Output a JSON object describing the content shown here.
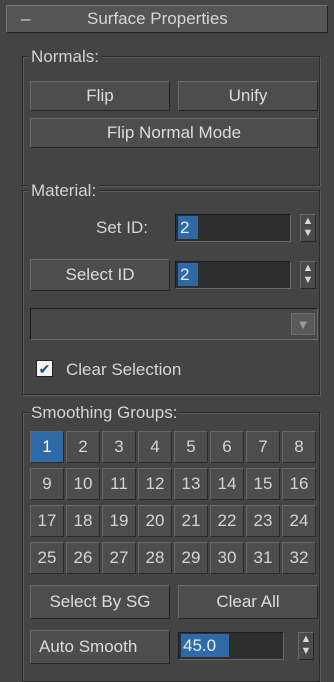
{
  "rollout": {
    "toggle": "–",
    "title": "Surface Properties"
  },
  "normals": {
    "legend": "Normals:",
    "flip_label": "Flip",
    "unify_label": "Unify",
    "flip_mode_label": "Flip Normal Mode"
  },
  "material": {
    "legend": "Material:",
    "set_id_label": "Set ID:",
    "set_id_value": "2",
    "select_id_label": "Select ID",
    "select_id_value": "2",
    "name_value": "",
    "clear_selection_label": "Clear Selection",
    "clear_selection_checked": true
  },
  "smoothing": {
    "legend": "Smoothing Groups:",
    "groups": [
      "1",
      "2",
      "3",
      "4",
      "5",
      "6",
      "7",
      "8",
      "9",
      "10",
      "11",
      "12",
      "13",
      "14",
      "15",
      "16",
      "17",
      "18",
      "19",
      "20",
      "21",
      "22",
      "23",
      "24",
      "25",
      "26",
      "27",
      "28",
      "29",
      "30",
      "31",
      "32"
    ],
    "active": [
      "1"
    ],
    "select_by_sg_label": "Select By SG",
    "clear_all_label": "Clear All",
    "auto_smooth_label": "Auto Smooth",
    "auto_smooth_value": "45.0"
  },
  "colors": {
    "background": "#444444",
    "accent": "#2f6aa8"
  }
}
